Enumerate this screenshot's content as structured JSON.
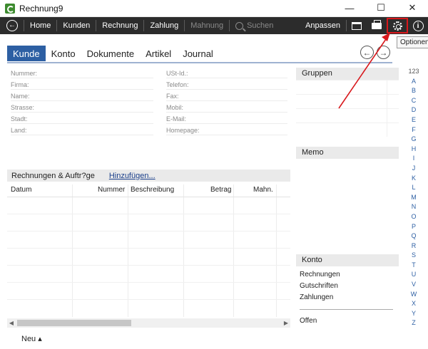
{
  "window": {
    "title": "Rechnung9",
    "minimize": "—",
    "maximize": "☐",
    "close": "✕"
  },
  "toolbar": {
    "back_icon": "←",
    "items": [
      "Home",
      "Kunden",
      "Rechnung",
      "Zahlung",
      "Mahnung"
    ],
    "search_label": "Suchen",
    "anpassen": "Anpassen",
    "info_icon": "i"
  },
  "tooltip": "Optionen",
  "tabs": [
    "Kunde",
    "Konto",
    "Dokumente",
    "Artikel",
    "Journal"
  ],
  "nav": {
    "prev": "←",
    "next": "→"
  },
  "form": {
    "left": [
      "Nummer:",
      "Firma:",
      "Name:",
      "Strasse:",
      "Stadt:",
      "Land:"
    ],
    "right": [
      "USt-Id.:",
      "Telefon:",
      "Fax:",
      "Mobil:",
      "E-Mail:",
      "Homepage:"
    ]
  },
  "panels": {
    "gruppen": "Gruppen",
    "memo": "Memo",
    "konto": "Konto",
    "konto_items": [
      "Rechnungen",
      "Gutschriften",
      "Zahlungen"
    ],
    "offen": "Offen"
  },
  "alphabet": [
    "123",
    "A",
    "B",
    "C",
    "D",
    "E",
    "F",
    "G",
    "H",
    "I",
    "J",
    "K",
    "L",
    "M",
    "N",
    "O",
    "P",
    "Q",
    "R",
    "S",
    "T",
    "U",
    "V",
    "W",
    "X",
    "Y",
    "Z"
  ],
  "invoices": {
    "title": "Rechnungen & Auftr?ge",
    "add_link": "Hinzufügen...",
    "columns": [
      "Datum",
      "Nummer",
      "Beschreibung",
      "Betrag",
      "Mahn."
    ]
  },
  "footer": {
    "new_label": "Neu ▴"
  },
  "colors": {
    "accent": "#2d5fa3",
    "toolbar_bg": "#2c2c2c",
    "highlight": "#d8181c"
  }
}
